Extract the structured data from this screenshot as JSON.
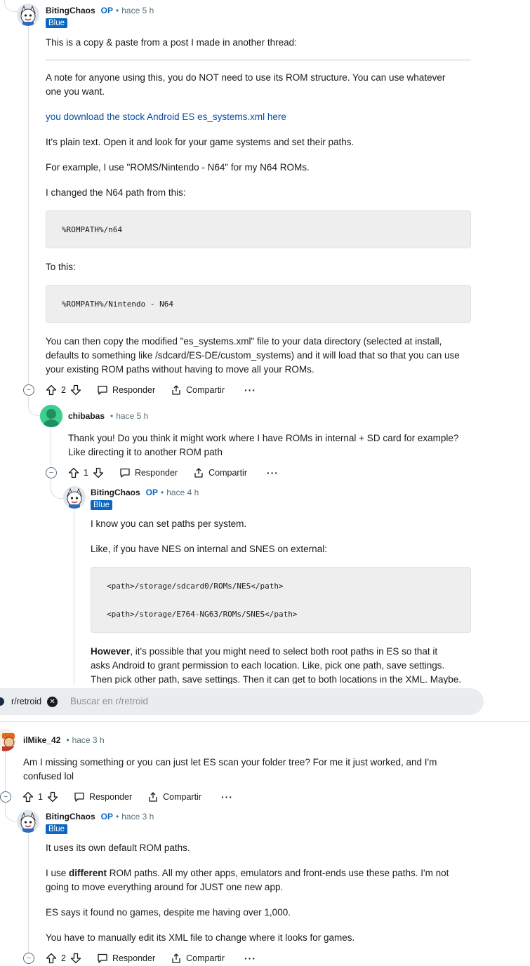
{
  "comments": {
    "c1": {
      "user": "BitingChaos",
      "op": "OP",
      "time": "hace 5 h",
      "flair": "Blue",
      "p1": "This is a copy & paste from a post I made in another thread:",
      "p2a": "A note for anyone using this, you do NOT need to use its ROM structure. You can use whatever",
      "p2b": "one you want.",
      "link": "you download the stock Android ES es_systems.xml here",
      "p3": "It's plain text. Open it and look for your game systems and set their paths.",
      "p4": "For example, I use \"ROMS/Nintendo - N64\" for my N64 ROMs.",
      "p5": "I changed the N64 path from this:",
      "code1": "%ROMPATH%/n64",
      "p6": "To this:",
      "code2": "%ROMPATH%/Nintendo - N64",
      "p7a": "You can then copy the modified \"es_systems.xml\" file to your data directory (selected at install,",
      "p7b": "defaults to something like /sdcard/ES-DE/custom_systems) and it will load that so that you can use",
      "p7c": "your existing ROM paths without having to move all your ROMs.",
      "votes": "2"
    },
    "c2": {
      "user": "chibabas",
      "time": "hace 5 h",
      "p1a": "Thank you! Do you think it might work where I have ROMs in internal + SD card for example?",
      "p1b": "Like directing it to another ROM path",
      "votes": "1"
    },
    "c3": {
      "user": "BitingChaos",
      "op": "OP",
      "time": "hace 4 h",
      "flair": "Blue",
      "p1": "I know you can set paths per system.",
      "p2": "Like, if you have NES on internal and SNES on external:",
      "code1": "<path>/storage/sdcard0/ROMs/NES</path>",
      "code2": "<path>/storage/E764-NG63/ROMs/SNES</path>",
      "p3bold": "However",
      "p3a": ", it's possible that you might need to select both root paths in ES so that it",
      "p3b": "asks Android to grant permission to each location. Like, pick one path, save settings.",
      "p3c": "Then pick other path, save settings. Then it can get to both locations in the XML. Maybe."
    },
    "c4": {
      "user": "ilMike_42",
      "time": "hace 3 h",
      "p1a": "Am I missing something or you can just let ES scan your folder tree? For me it just worked, and I'm",
      "p1b": "confused lol",
      "votes": "1"
    },
    "c5": {
      "user": "BitingChaos",
      "op": "OP",
      "time": "hace 3 h",
      "flair": "Blue",
      "p1": "It uses its own default ROM paths.",
      "p2pre": "I use ",
      "p2bold": "different",
      "p2a": " ROM paths. All my other apps, emulators and front-ends use these paths. I'm not",
      "p2b": "going to move everything around for JUST one new app.",
      "p3": "ES says it found no games, despite me having over 1,000.",
      "p4": "You have to manually edit its XML file to change where it looks for games.",
      "votes": "2"
    }
  },
  "actions": {
    "reply": "Responder",
    "share": "Compartir",
    "more": "···",
    "collapse": "−"
  },
  "search": {
    "chip": "r/retroid",
    "placeholder": "Buscar en r/retroid"
  }
}
